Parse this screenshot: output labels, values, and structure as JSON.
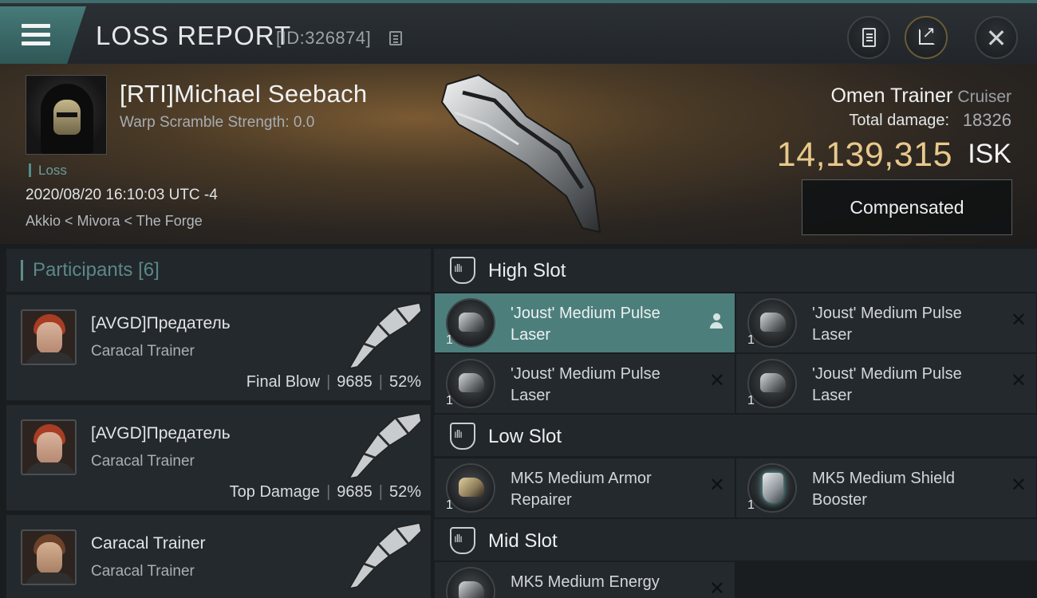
{
  "header": {
    "title": "LOSS REPORT",
    "report_id": "[ID:326874]",
    "icons": [
      "menu-icon",
      "copy-icon",
      "document-icon",
      "share-icon",
      "close-icon"
    ]
  },
  "victim": {
    "name": "[RTI]Michael Seebach",
    "warp_scramble": "Warp Scramble Strength: 0.0",
    "result_tag": "Loss",
    "datetime": "2020/08/20 16:10:03 UTC -4",
    "location": "Akkio < Mivora < The Forge",
    "ship_name": "Omen Trainer",
    "ship_class": "Cruiser",
    "total_damage_label": "Total damage:",
    "total_damage": "18326",
    "isk_value": "14,139,315",
    "isk_unit": "ISK",
    "compensate_label": "Compensated"
  },
  "participants": {
    "label": "Participants",
    "count": "[6]",
    "rows": [
      {
        "name": "[AVGD]Предатель",
        "ship": "Caracal Trainer",
        "role": "Final Blow",
        "damage": "9685",
        "percent": "52%"
      },
      {
        "name": "[AVGD]Предатель",
        "ship": "Caracal Trainer",
        "role": "Top Damage",
        "damage": "9685",
        "percent": "52%"
      },
      {
        "name": "Caracal Trainer",
        "ship": "Caracal Trainer"
      }
    ]
  },
  "slots": {
    "high": {
      "title": "High Slot",
      "modules": [
        {
          "name": "'Joust' Medium Pulse Laser",
          "qty": "1"
        },
        {
          "name": "'Joust' Medium Pulse Laser",
          "qty": "1"
        },
        {
          "name": "'Joust' Medium Pulse Laser",
          "qty": "1"
        },
        {
          "name": "'Joust' Medium Pulse Laser",
          "qty": "1"
        }
      ]
    },
    "low": {
      "title": "Low Slot",
      "modules": [
        {
          "name": "MK5 Medium Armor Repairer",
          "qty": "1"
        },
        {
          "name": "MK5 Medium Shield Booster",
          "qty": "1"
        }
      ]
    },
    "mid": {
      "title": "Mid Slot",
      "modules": [
        {
          "name": "MK5 Medium Energy",
          "qty": "1"
        }
      ]
    }
  },
  "colors": {
    "accent": "#4c7f7c",
    "isk": "#e8c98b",
    "loss": "#6d9c9a"
  }
}
